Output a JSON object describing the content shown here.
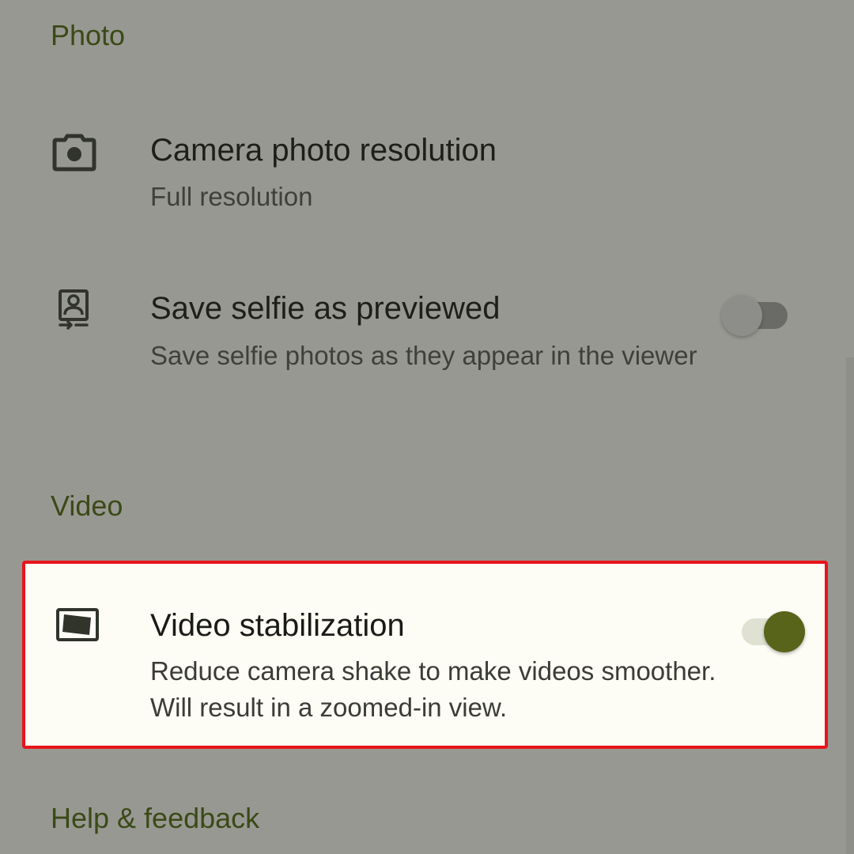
{
  "sections": {
    "photo": "Photo",
    "video": "Video",
    "help": "Help & feedback"
  },
  "settings": {
    "resolution": {
      "title": "Camera photo resolution",
      "subtitle": "Full resolution",
      "icon": "camera-icon"
    },
    "selfie": {
      "title": "Save selfie as previewed",
      "subtitle": "Save selfie photos as they appear in the viewer",
      "icon": "selfie-portrait-icon",
      "enabled": false
    },
    "stabilization": {
      "title": "Video stabilization",
      "subtitle": "Reduce camera shake to make videos smoother. Will result in a zoomed-in view.",
      "icon": "video-stabilization-icon",
      "enabled": true
    }
  },
  "colors": {
    "scrim_background": "#989893",
    "section_header": "#3a4a16",
    "highlight_border": "#e8141c",
    "highlight_card": "#fdfcf5",
    "toggle_on_thumb": "#586419",
    "toggle_on_track": "#dfe1d2",
    "toggle_off_thumb": "#8d8d89",
    "toggle_off_track": "#6a6a66"
  }
}
